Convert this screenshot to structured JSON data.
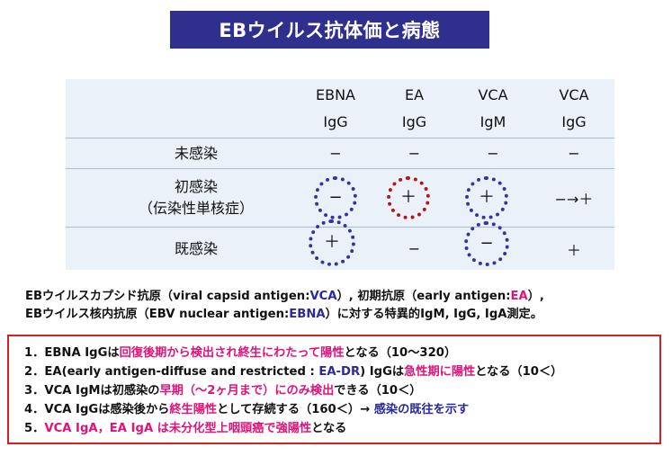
{
  "title": "EBウイルス抗体価と病態",
  "table": {
    "columns": [
      {
        "line1": "EBNA",
        "line2": "IgG"
      },
      {
        "line1": "EA",
        "line2": "IgG"
      },
      {
        "line1": "VCA",
        "line2": "IgM"
      },
      {
        "line1": "VCA",
        "line2": "IgG"
      }
    ],
    "rows": [
      {
        "label": "未感染",
        "label2": "",
        "cells": [
          "−",
          "−",
          "−",
          "−"
        ]
      },
      {
        "label": "初感染",
        "label2": "（伝染性単核症）",
        "cells": [
          "−",
          "＋",
          "＋",
          "−→＋"
        ]
      },
      {
        "label": "既感染",
        "label2": "",
        "cells": [
          "＋",
          "−",
          "−",
          "＋"
        ]
      }
    ]
  },
  "note": {
    "line1_a": "EBウイルスカプシド抗原（viral capsid antigen:",
    "line1_b": "VCA",
    "line1_c": "）, 初期抗原（early antigen:",
    "line1_d": "EA",
    "line1_e": "）,",
    "line2_a": "EBウイルス核内抗原（EBV nuclear antigen:",
    "line2_b": "EBNA",
    "line2_c": "）に対する特異的IgM, IgG, IgA測定。"
  },
  "list": {
    "i1_a": "1．EBNA IgGは",
    "i1_b": "回復後期から検出され終生にわたって陽性",
    "i1_c": "となる（10〜320）",
    "i2_a": "2．EA(early antigen-diffuse and restricted : ",
    "i2_b": "EA-DR",
    "i2_c": ") IgGは",
    "i2_d": "急性期に陽性",
    "i2_e": "となる（10＜）",
    "i3_a": "3．VCA IgMは初感染の",
    "i3_b": "早期（〜2ヶ月まで）にのみ検出",
    "i3_c": "できる（10＜）",
    "i4_a": "4．VCA IgGは感染後から",
    "i4_b": "終生陽性",
    "i4_c": "として存続する（160＜）→ ",
    "i4_d": "感染の既往を示す",
    "i5_a": "5．",
    "i5_b": "VCA IgA",
    "i5_c": "，",
    "i5_d": "EA IgA",
    "i5_e": " は未分化型上咽頭癌で強陽性",
    "i5_f": "となる"
  }
}
